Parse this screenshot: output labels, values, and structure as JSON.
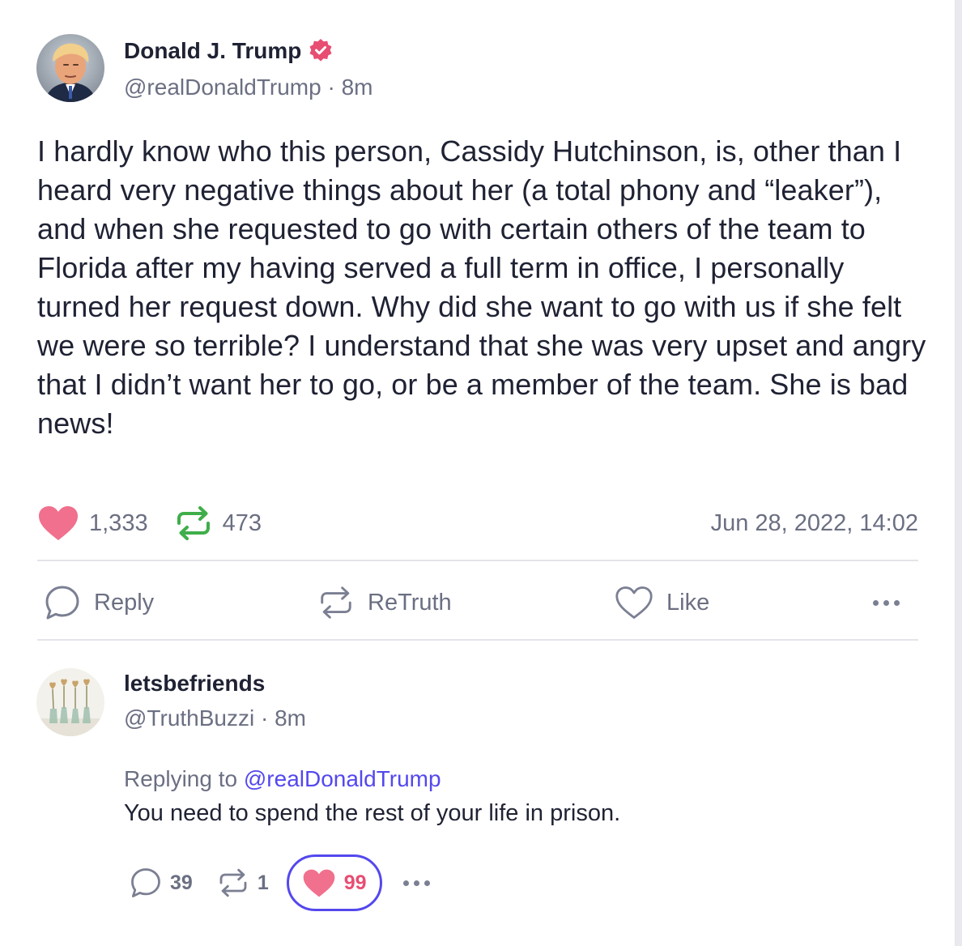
{
  "post": {
    "author_name": "Donald J. Trump",
    "author_handle": "@realDonaldTrump",
    "separator": "·",
    "time_ago": "8m",
    "body": "I hardly know who this person, Cassidy Hutchinson, is, other than I heard very negative things about her (a total phony and “leaker”), and when she requested to go with certain others of the team to Florida after my having served a full term in office, I personally turned her request down. Why did she want to go with us if she felt we were so terrible? I understand that she was very upset and angry that I didn’t want her to go, or be a member of the team. She is bad news!",
    "likes_count": "1,333",
    "retruths_count": "473",
    "timestamp": "Jun 28, 2022, 14:02",
    "verified_icon": "verified-badge-icon"
  },
  "actions": {
    "reply_label": "Reply",
    "retruth_label": "ReTruth",
    "like_label": "Like",
    "more_icon": "more-dots-icon"
  },
  "reply": {
    "author_name": "letsbefriends",
    "author_handle": "@TruthBuzzi",
    "separator": "·",
    "time_ago": "8m",
    "replying_to_label": "Replying to",
    "replying_to_handle": "@realDonaldTrump",
    "body": "You need to spend the rest of your life in prison.",
    "replies_count": "39",
    "retruths_count": "1",
    "likes_count": "99"
  },
  "colors": {
    "accent": "#5448ee",
    "like": "#e84d72",
    "retruth": "#3fae4a",
    "verified": "#e84d72",
    "muted_text": "#6b6f82"
  }
}
